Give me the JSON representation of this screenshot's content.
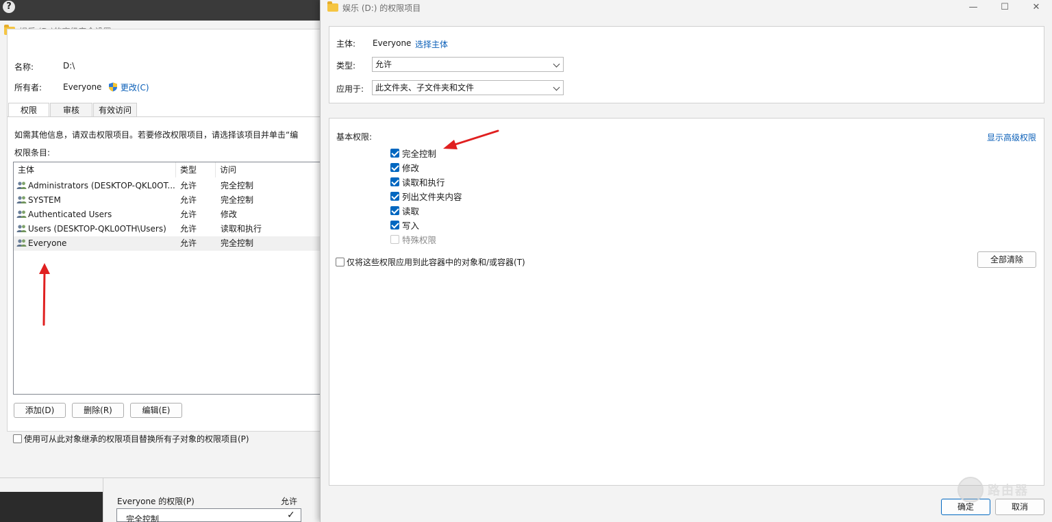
{
  "help_icon": "?",
  "left_window": {
    "title": "娱乐 (D:)的高级安全设置",
    "name_label": "名称:",
    "name_value": "D:\\",
    "owner_label": "所有者:",
    "owner_value": "Everyone",
    "change_link": "更改(C)",
    "tabs": [
      {
        "label": "权限",
        "active": true
      },
      {
        "label": "审核",
        "active": false
      },
      {
        "label": "有效访问",
        "active": false
      }
    ],
    "hint": "如需其他信息，请双击权限项目。若要修改权限项目，请选择该项目并单击“编",
    "entries_label": "权限条目:",
    "columns": [
      "主体",
      "类型",
      "访问"
    ],
    "rows": [
      {
        "principal": "Administrators (DESKTOP-QKL0OT...",
        "type": "允许",
        "access": "完全控制"
      },
      {
        "principal": "SYSTEM",
        "type": "允许",
        "access": "完全控制"
      },
      {
        "principal": "Authenticated Users",
        "type": "允许",
        "access": "修改"
      },
      {
        "principal": "Users (DESKTOP-QKL0OTH\\Users)",
        "type": "允许",
        "access": "读取和执行"
      },
      {
        "principal": "Everyone",
        "type": "允许",
        "access": "完全控制",
        "selected": true
      }
    ],
    "buttons": {
      "add": "添加(D)",
      "remove": "删除(R)",
      "edit": "编辑(E)"
    },
    "replace_checkbox": "使用可从此对象继承的权限项目替换所有子对象的权限项目(P)"
  },
  "bottom_window": {
    "perm_label": "Everyone 的权限(P)",
    "allow_col": "允许",
    "row_label": "完全控制",
    "row_check": "✓"
  },
  "right_window": {
    "title": "娱乐 (D:) 的权限项目",
    "controls": {
      "minimize": "—",
      "maximize": "☐",
      "close": "✕"
    },
    "principal_label": "主体:",
    "principal_value": "Everyone",
    "select_principal_link": "选择主体",
    "type_label": "类型:",
    "type_value": "允许",
    "applies_label": "应用于:",
    "applies_value": "此文件夹、子文件夹和文件",
    "basic_perms_label": "基本权限:",
    "show_advanced_link": "显示高级权限",
    "permissions": [
      {
        "label": "完全控制",
        "checked": true,
        "disabled": false
      },
      {
        "label": "修改",
        "checked": true,
        "disabled": false
      },
      {
        "label": "读取和执行",
        "checked": true,
        "disabled": false
      },
      {
        "label": "列出文件夹内容",
        "checked": true,
        "disabled": false
      },
      {
        "label": "读取",
        "checked": true,
        "disabled": false
      },
      {
        "label": "写入",
        "checked": true,
        "disabled": false
      },
      {
        "label": "特殊权限",
        "checked": false,
        "disabled": true
      }
    ],
    "apply_only_checkbox": "仅将这些权限应用到此容器中的对象和/或容器(T)",
    "clear_all_button": "全部清除",
    "ok_button": "确定",
    "cancel_button": "取消"
  },
  "watermark": {
    "text": "路由器"
  },
  "colors": {
    "accent": "#0067c0",
    "link": "#0a5fb8",
    "arrow": "#e02020"
  }
}
